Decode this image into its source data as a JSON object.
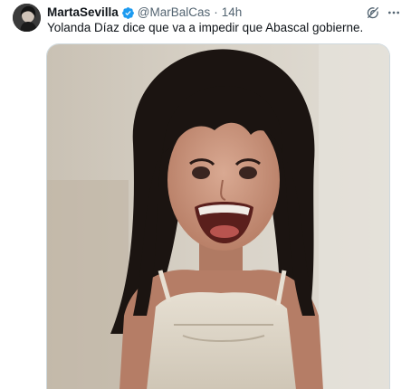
{
  "tweet": {
    "author": {
      "display_name": "MartaSevilla",
      "handle": "@MarBalCas",
      "verified": true
    },
    "separator": "·",
    "time": "14h",
    "text": "Yolanda Díaz dice que va a impedir que Abascal gobierne.",
    "icons": {
      "avatar": "avatar",
      "verified": "verified-badge-icon",
      "grok": "grok-icon",
      "more": "more-options-icon"
    },
    "colors": {
      "name": "#0f1419",
      "secondary": "#536471",
      "verified": "#1d9bf0",
      "border": "#cfd9de"
    },
    "media": {
      "kind": "photo"
    }
  }
}
